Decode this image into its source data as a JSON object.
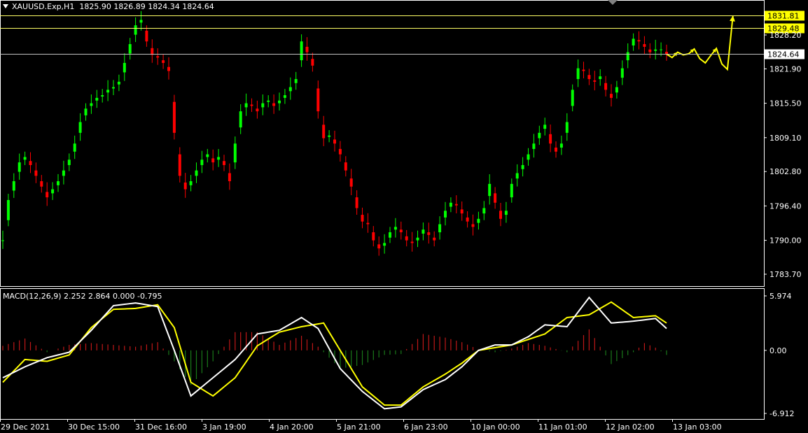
{
  "header": {
    "symbol": "XAUUSD.Exp,H1",
    "ohlc": "1825.90 1826.89 1824.34 1824.64"
  },
  "macd": {
    "label": "MACD(12,26,9) 2.252 2.864 0.000 -0.795",
    "axis_labels": [
      "5.974",
      "0.00",
      "-6.912"
    ]
  },
  "colors": {
    "background": "#000000",
    "bull": "#00ff00",
    "bear": "#ff0000",
    "forecast": "#ffff00",
    "macd_line": "#ffffff",
    "signal_line": "#ffff00",
    "grid_line": "#c0c0c0",
    "text": "#ffffff"
  },
  "chart_data": {
    "type": "candlestick",
    "symbol": "XAUUSD",
    "timeframe": "H1",
    "ylim": [
      1780.0,
      1836.0
    ],
    "y_ticks": [
      "1828.20",
      "1821.90",
      "1815.50",
      "1809.10",
      "1802.80",
      "1796.40",
      "1790.00",
      "1783.70"
    ],
    "x_ticks": [
      "29 Dec 2021",
      "30 Dec 15:00",
      "31 Dec 16:00",
      "3 Jan 19:00",
      "4 Jan 20:00",
      "5 Jan 21:00",
      "6 Jan 23:00",
      "10 Jan 00:00",
      "11 Jan 01:00",
      "12 Jan 02:00",
      "13 Jan 03:00"
    ],
    "horizontal_levels": [
      {
        "value": 1831.81,
        "label": "1831.81",
        "highlight": true
      },
      {
        "value": 1829.48,
        "label": "1829.48",
        "highlight": true
      },
      {
        "value": 1824.64,
        "label": "1824.64",
        "highlight": false
      }
    ],
    "price_path": [
      [
        0,
        1790.0
      ],
      [
        1,
        1797.5
      ],
      [
        2,
        1801.0
      ],
      [
        3,
        1804.5
      ],
      [
        4,
        1805.5
      ],
      [
        5,
        1804.0
      ],
      [
        6,
        1802.0
      ],
      [
        7,
        1800.0
      ],
      [
        8,
        1798.0
      ],
      [
        9,
        1799.5
      ],
      [
        10,
        1801.0
      ],
      [
        11,
        1803.0
      ],
      [
        12,
        1805.0
      ],
      [
        13,
        1808.0
      ],
      [
        14,
        1812.0
      ],
      [
        15,
        1814.5
      ],
      [
        16,
        1815.5
      ],
      [
        17,
        1816.5
      ],
      [
        18,
        1817.0
      ],
      [
        19,
        1818.0
      ],
      [
        20,
        1818.5
      ],
      [
        21,
        1819.5
      ],
      [
        22,
        1823.0
      ],
      [
        23,
        1826.5
      ],
      [
        24,
        1830.0
      ],
      [
        25,
        1831.0
      ],
      [
        26,
        1827.0
      ],
      [
        27,
        1824.5
      ],
      [
        28,
        1824.0
      ],
      [
        29,
        1823.0
      ],
      [
        30,
        1821.5
      ],
      [
        31,
        1810.0
      ],
      [
        32,
        1802.0
      ],
      [
        33,
        1799.5
      ],
      [
        34,
        1801.0
      ],
      [
        35,
        1803.0
      ],
      [
        36,
        1805.0
      ],
      [
        37,
        1806.0
      ],
      [
        38,
        1804.5
      ],
      [
        39,
        1805.5
      ],
      [
        40,
        1804.0
      ],
      [
        41,
        1801.0
      ],
      [
        42,
        1808.0
      ],
      [
        43,
        1814.0
      ],
      [
        44,
        1815.5
      ],
      [
        45,
        1815.0
      ],
      [
        46,
        1814.0
      ],
      [
        47,
        1815.5
      ],
      [
        48,
        1816.0
      ],
      [
        49,
        1815.0
      ],
      [
        50,
        1816.0
      ],
      [
        51,
        1817.0
      ],
      [
        52,
        1818.5
      ],
      [
        53,
        1820.0
      ],
      [
        54,
        1827.0
      ],
      [
        55,
        1825.0
      ],
      [
        56,
        1822.5
      ],
      [
        57,
        1814.0
      ],
      [
        58,
        1809.0
      ],
      [
        59,
        1809.5
      ],
      [
        60,
        1808.0
      ],
      [
        61,
        1806.0
      ],
      [
        62,
        1803.0
      ],
      [
        63,
        1800.0
      ],
      [
        64,
        1796.0
      ],
      [
        65,
        1793.5
      ],
      [
        66,
        1793.0
      ],
      [
        67,
        1790.0
      ],
      [
        68,
        1788.5
      ],
      [
        69,
        1789.5
      ],
      [
        70,
        1791.5
      ],
      [
        71,
        1792.5
      ],
      [
        72,
        1791.5
      ],
      [
        73,
        1790.0
      ],
      [
        74,
        1789.5
      ],
      [
        75,
        1790.5
      ],
      [
        76,
        1792.0
      ],
      [
        77,
        1791.0
      ],
      [
        78,
        1790.0
      ],
      [
        79,
        1793.0
      ],
      [
        80,
        1795.5
      ],
      [
        81,
        1797.0
      ],
      [
        82,
        1796.5
      ],
      [
        83,
        1795.0
      ],
      [
        84,
        1793.5
      ],
      [
        85,
        1792.5
      ],
      [
        86,
        1794.0
      ],
      [
        87,
        1796.0
      ],
      [
        88,
        1800.5
      ],
      [
        89,
        1797.0
      ],
      [
        90,
        1794.0
      ],
      [
        91,
        1795.5
      ],
      [
        92,
        1800.5
      ],
      [
        93,
        1802.5
      ],
      [
        94,
        1804.0
      ],
      [
        95,
        1806.0
      ],
      [
        96,
        1808.0
      ],
      [
        97,
        1810.0
      ],
      [
        98,
        1811.5
      ],
      [
        99,
        1808.0
      ],
      [
        100,
        1806.5
      ],
      [
        101,
        1808.0
      ],
      [
        102,
        1812.0
      ],
      [
        103,
        1818.0
      ],
      [
        104,
        1822.0
      ],
      [
        105,
        1821.5
      ],
      [
        106,
        1820.0
      ],
      [
        107,
        1819.5
      ],
      [
        108,
        1820.5
      ],
      [
        109,
        1818.0
      ],
      [
        110,
        1816.5
      ],
      [
        111,
        1818.5
      ],
      [
        112,
        1822.0
      ],
      [
        113,
        1825.0
      ],
      [
        114,
        1827.5
      ],
      [
        115,
        1827.0
      ],
      [
        116,
        1826.0
      ],
      [
        117,
        1825.0
      ],
      [
        118,
        1825.5
      ],
      [
        119,
        1825.5
      ],
      [
        120,
        1824.64
      ]
    ],
    "forecast_path": [
      [
        120,
        1824.64
      ],
      [
        121,
        1824.0
      ],
      [
        122,
        1825.0
      ],
      [
        123,
        1824.5
      ],
      [
        124,
        1824.7
      ],
      [
        125,
        1825.6
      ],
      [
        126,
        1823.8
      ],
      [
        127,
        1823.0
      ],
      [
        128,
        1824.4
      ],
      [
        129,
        1825.7
      ],
      [
        130,
        1822.8
      ],
      [
        131,
        1821.8
      ],
      [
        132,
        1831.81
      ]
    ],
    "macd_line": [
      [
        0,
        -3.0
      ],
      [
        4,
        -1.8
      ],
      [
        8,
        -0.8
      ],
      [
        12,
        -0.2
      ],
      [
        16,
        2.2
      ],
      [
        20,
        4.9
      ],
      [
        24,
        5.2
      ],
      [
        28,
        4.8
      ],
      [
        31,
        0.0
      ],
      [
        34,
        -5.0
      ],
      [
        38,
        -3.0
      ],
      [
        42,
        -1.0
      ],
      [
        46,
        1.8
      ],
      [
        50,
        2.2
      ],
      [
        54,
        3.6
      ],
      [
        57,
        2.4
      ],
      [
        61,
        -2.0
      ],
      [
        65,
        -4.5
      ],
      [
        69,
        -6.4
      ],
      [
        72,
        -6.2
      ],
      [
        76,
        -4.3
      ],
      [
        80,
        -3.2
      ],
      [
        83,
        -1.8
      ],
      [
        86,
        0.0
      ],
      [
        89,
        0.6
      ],
      [
        92,
        0.6
      ],
      [
        95,
        1.5
      ],
      [
        98,
        2.8
      ],
      [
        102,
        2.6
      ],
      [
        106,
        5.8
      ],
      [
        110,
        3.0
      ],
      [
        114,
        3.2
      ],
      [
        118,
        3.5
      ],
      [
        120,
        2.4
      ]
    ],
    "signal_line": [
      [
        0,
        -3.5
      ],
      [
        4,
        -1.0
      ],
      [
        8,
        -1.2
      ],
      [
        12,
        -0.5
      ],
      [
        16,
        2.5
      ],
      [
        20,
        4.5
      ],
      [
        24,
        4.6
      ],
      [
        28,
        5.0
      ],
      [
        31,
        2.5
      ],
      [
        34,
        -3.5
      ],
      [
        38,
        -5.0
      ],
      [
        42,
        -3.0
      ],
      [
        46,
        0.5
      ],
      [
        50,
        2.0
      ],
      [
        54,
        2.6
      ],
      [
        58,
        3.0
      ],
      [
        61,
        0.0
      ],
      [
        65,
        -4.0
      ],
      [
        69,
        -6.0
      ],
      [
        72,
        -6.0
      ],
      [
        76,
        -4.0
      ],
      [
        80,
        -2.6
      ],
      [
        83,
        -1.4
      ],
      [
        86,
        0.0
      ],
      [
        89,
        0.3
      ],
      [
        92,
        0.6
      ],
      [
        95,
        1.2
      ],
      [
        98,
        1.8
      ],
      [
        102,
        3.6
      ],
      [
        106,
        3.9
      ],
      [
        110,
        5.3
      ],
      [
        114,
        3.6
      ],
      [
        118,
        3.8
      ],
      [
        120,
        3.0
      ]
    ],
    "histogram": [
      [
        0,
        0.5
      ],
      [
        4,
        1.3
      ],
      [
        8,
        -0.2
      ],
      [
        12,
        0.6
      ],
      [
        16,
        0.8
      ],
      [
        20,
        0.6
      ],
      [
        24,
        0.4
      ],
      [
        28,
        0.9
      ],
      [
        31,
        -1.2
      ],
      [
        34,
        -3.8
      ],
      [
        38,
        -1.2
      ],
      [
        42,
        2.0
      ],
      [
        46,
        2.0
      ],
      [
        50,
        0.6
      ],
      [
        54,
        1.6
      ],
      [
        57,
        0.4
      ],
      [
        61,
        -2.0
      ],
      [
        65,
        -1.6
      ],
      [
        69,
        -0.5
      ],
      [
        72,
        -0.4
      ],
      [
        76,
        1.8
      ],
      [
        80,
        1.4
      ],
      [
        83,
        0.9
      ],
      [
        86,
        0.1
      ],
      [
        89,
        -0.2
      ],
      [
        92,
        0.2
      ],
      [
        95,
        0.8
      ],
      [
        98,
        0.5
      ],
      [
        102,
        -0.2
      ],
      [
        106,
        2.3
      ],
      [
        110,
        -1.5
      ],
      [
        114,
        -0.2
      ],
      [
        116,
        0.8
      ],
      [
        118,
        0.3
      ],
      [
        120,
        -0.5
      ]
    ],
    "macd_ylim": [
      -6.912,
      5.974
    ]
  }
}
